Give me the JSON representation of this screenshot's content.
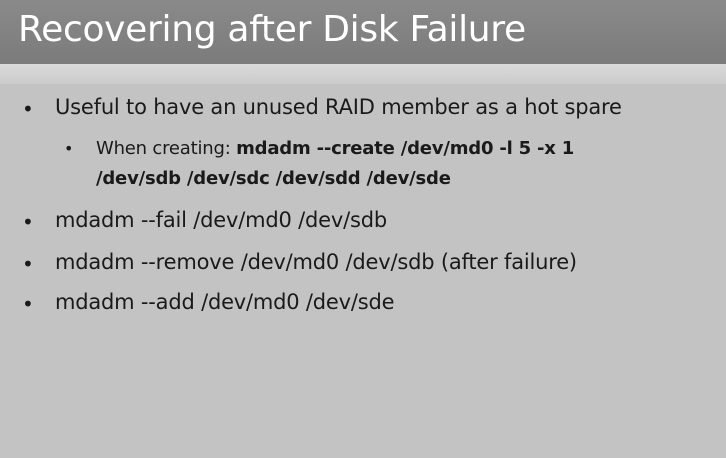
{
  "title": "Recovering after Disk Failure",
  "bullets": {
    "b1": "Useful to have an unused RAID member as a hot spare",
    "b1_sub_prefix": "When creating: ",
    "b1_sub_cmd_line1": "mdadm --create /dev/md0 -l 5 -x 1",
    "b1_sub_cmd_line2": "/dev/sdb /dev/sdc /dev/sdd /dev/sde",
    "b2": "mdadm --fail /dev/md0 /dev/sdb",
    "b3": "mdadm --remove /dev/md0 /dev/sdb (after failure)",
    "b4": "mdadm --add /dev/md0 /dev/sde"
  },
  "bullet_glyph": "•"
}
